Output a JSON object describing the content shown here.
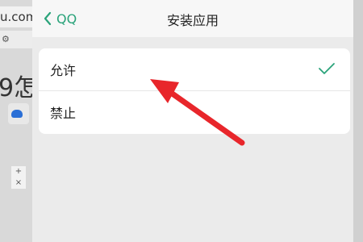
{
  "background": {
    "url_fragment": "u.com",
    "small_icon": "gear-icon",
    "big_text": "9怎",
    "grid_glyphs": [
      "+",
      "×"
    ]
  },
  "header": {
    "back_label": "QQ",
    "title": "安装应用"
  },
  "options": [
    {
      "label": "允许",
      "selected": true
    },
    {
      "label": "禁止",
      "selected": false
    }
  ],
  "colors": {
    "accent": "#2aa37a",
    "annotation_arrow": "#e8262b"
  }
}
